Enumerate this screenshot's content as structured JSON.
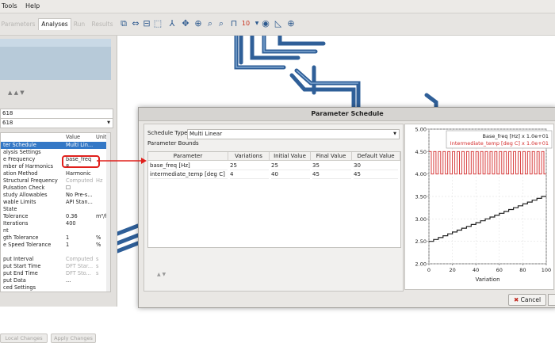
{
  "menu": {
    "tools": "Tools",
    "help": "Help"
  },
  "tabs": [
    {
      "label": "Parameters",
      "active": false
    },
    {
      "label": "Analyses",
      "active": true
    },
    {
      "label": "Run",
      "active": false
    },
    {
      "label": "Results",
      "active": false
    }
  ],
  "left_panel": {
    "combo1": "618",
    "combo2": "618",
    "prop_header": {
      "name": "",
      "value": "Value",
      "unit": "Unit"
    },
    "rows": [
      {
        "name": "ter Schedule",
        "value": "Multi Lin...",
        "unit": "",
        "selected": true
      },
      {
        "name": "alysis Settings",
        "value": "",
        "unit": ""
      },
      {
        "name": "e Frequency",
        "value": "base_freq",
        "unit": ""
      },
      {
        "name": "mber of Harmonics",
        "value": "8",
        "unit": ""
      },
      {
        "name": "ation Method",
        "value": "Harmonic",
        "unit": ""
      },
      {
        "name": "Structural Frequency",
        "value": "Computed",
        "unit": "Hz",
        "muted": true
      },
      {
        "name": "Pulsation Check",
        "value": "☐",
        "unit": ""
      },
      {
        "name": "study Allowables",
        "value": "No Pre-s...",
        "unit": ""
      },
      {
        "name": "wable Limits",
        "value": "API Stan...",
        "unit": ""
      },
      {
        "name": "State",
        "value": "",
        "unit": ""
      },
      {
        "name": "Tolerance",
        "value": "0.36",
        "unit": "m³/h"
      },
      {
        "name": "Iterations",
        "value": "400",
        "unit": ""
      },
      {
        "name": "nt",
        "value": "",
        "unit": ""
      },
      {
        "name": "gth Tolerance",
        "value": "1",
        "unit": "%"
      },
      {
        "name": "e Speed Tolerance",
        "value": "1",
        "unit": "%"
      },
      {
        "name": "",
        "value": "",
        "unit": ""
      },
      {
        "name": "put Interval",
        "value": "Computed",
        "unit": "s",
        "muted": true
      },
      {
        "name": "put Start Time",
        "value": "DFT Star...",
        "unit": "s",
        "muted": true
      },
      {
        "name": "put End Time",
        "value": "DFT Sto...",
        "unit": "s",
        "muted": true
      },
      {
        "name": "put Data",
        "value": "...",
        "unit": ""
      },
      {
        "name": "ced Settings",
        "value": "",
        "unit": ""
      }
    ],
    "revert_label": "Local Changes",
    "apply_label": "Apply Changes"
  },
  "dialog": {
    "title": "Parameter Schedule",
    "schedule_type_label": "Schedule Type",
    "schedule_type_value": "Multi Linear",
    "bounds_label": "Parameter Bounds",
    "columns": [
      "Parameter",
      "Variations",
      "Initial Value",
      "Final Value",
      "Default Value"
    ],
    "rows": [
      [
        "base_freq [Hz]",
        "25",
        "25",
        "35",
        "30"
      ],
      [
        "intermediate_temp [deg C]",
        "4",
        "40",
        "45",
        "45"
      ]
    ],
    "cancel_label": "Cancel"
  },
  "chart_data": {
    "type": "line",
    "xlabel": "Variation",
    "ylabel": "",
    "xlim": [
      0,
      100
    ],
    "ylim": [
      2.0,
      5.0
    ],
    "xticks": [
      0,
      20,
      40,
      60,
      80,
      100
    ],
    "yticks": [
      "2.00",
      "2.50",
      "3.00",
      "3.50",
      "4.00",
      "4.50",
      "5.00"
    ],
    "legend_position": "top-right",
    "series": [
      {
        "name": "Base_freq [Hz] x 1.0e+01",
        "color": "#222222",
        "style": "staircase",
        "x_start": 0,
        "x_end": 100,
        "y_start": 2.5,
        "y_end": 3.5
      },
      {
        "name": "Intermediate_temp [deg C] x 1.0e+01",
        "color": "#d42b2b",
        "style": "square-wave",
        "x_start": 0,
        "x_end": 100,
        "y_low": 4.0,
        "y_high": 4.5,
        "cycles": 25
      }
    ]
  },
  "colors": {
    "accent": "#3478c6",
    "callout": "#e0201c",
    "pipe": "#3a6ea8"
  }
}
